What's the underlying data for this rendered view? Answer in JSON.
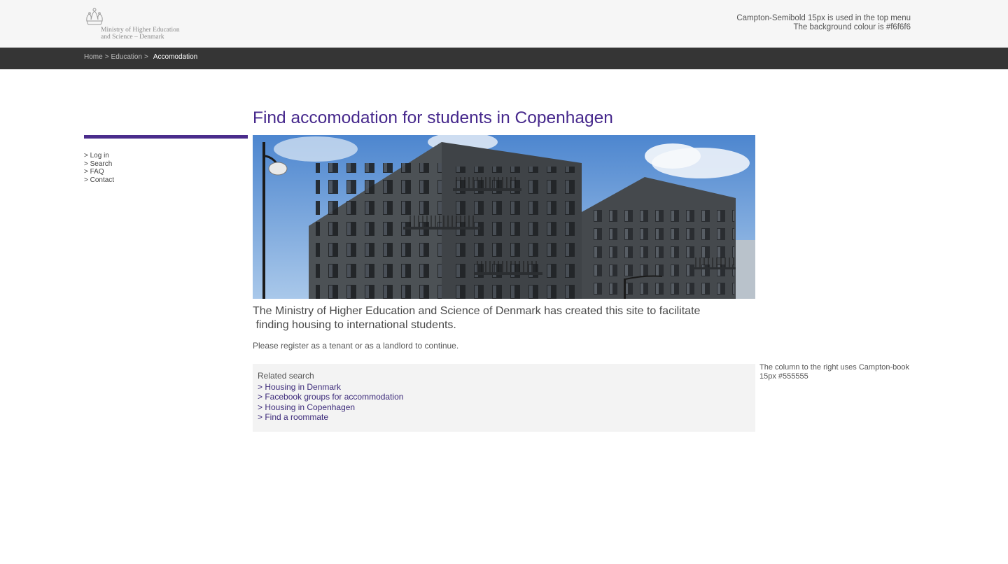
{
  "header": {
    "logo_text": [
      "Ministry of Higher Education",
      "and Science – Denmark"
    ],
    "note_lines": [
      "Campton-Semibold 15px is used in the top menu",
      "The background colour is #f6f6f6"
    ]
  },
  "breadcrumb": {
    "items": [
      "Home",
      "Education"
    ],
    "separator": ">",
    "current": "Accomodation"
  },
  "sidebar": {
    "items": [
      {
        "label": "> Log in"
      },
      {
        "label": "> Search"
      },
      {
        "label": "> FAQ"
      },
      {
        "label": "> Contact"
      }
    ]
  },
  "main": {
    "title": "Find accomodation for students in Copenhagen",
    "intro_lines": [
      "The Ministry of Higher Education and Science of Denmark has created this site to facilitate",
      " finding housing to international students."
    ],
    "note": "Please register as a tenant or as a landlord to continue."
  },
  "related": {
    "title": "Related search",
    "links": [
      "> Housing in Denmark",
      "> Facebook groups for accommodation",
      "> Housing in Copenhagen",
      "> Find a roommate"
    ]
  },
  "right_column": {
    "note": "The column to the right uses Campton-book 15px #555555"
  },
  "colors": {
    "header_bg": "#f6f6f6",
    "crumbbar_bg": "#353535",
    "accent_purple": "#46288c",
    "body_text": "#555555"
  }
}
